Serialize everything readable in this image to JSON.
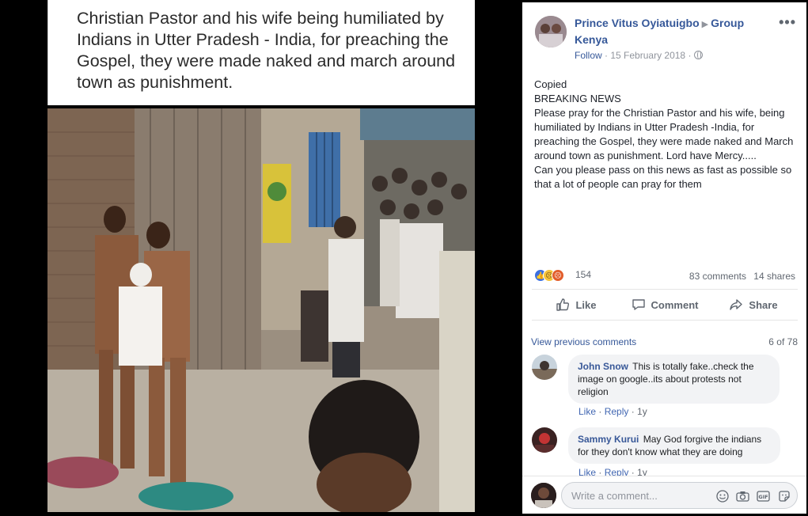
{
  "image_caption": "Christian Pastor and his wife being humiliated by Indians in Utter Pradesh - India, for preaching the Gospel, they were made naked and march around town as punishment.",
  "post": {
    "author": "Prince Vitus Oyiatuigbo",
    "group": "Group Kenya",
    "follow_label": "Follow",
    "date": "15 February 2018",
    "separator": "·",
    "body_lines": [
      "Copied",
      "BREAKING NEWS",
      "Please pray for the Christian Pastor and his wife, being humiliated by Indians in Utter Pradesh -India, for preaching the Gospel, they were made naked and March around town as punishment. Lord have Mercy.....",
      "Can you please pass on this news as fast as possible so that a lot of people can pray for them"
    ],
    "reaction_count": "154",
    "comments_count": "83 comments",
    "shares_count": "14 shares"
  },
  "actions": {
    "like": "Like",
    "comment": "Comment",
    "share": "Share"
  },
  "comments_section": {
    "view_previous": "View previous comments",
    "page_count": "6 of 78",
    "comments": [
      {
        "author": "John Snow",
        "text": "This is totally fake..check the image on google..its about protests not religion",
        "like": "Like",
        "reply": "Reply",
        "age": "1y"
      },
      {
        "author": "Sammy Kurui",
        "text": "May God forgive the indians for they don't know what they are doing",
        "like": "Like",
        "reply": "Reply",
        "age": "1y"
      }
    ]
  },
  "composer": {
    "placeholder": "Write a comment..."
  },
  "colors": {
    "link": "#365899",
    "muted": "#90949c",
    "bubble": "#f2f3f5"
  }
}
